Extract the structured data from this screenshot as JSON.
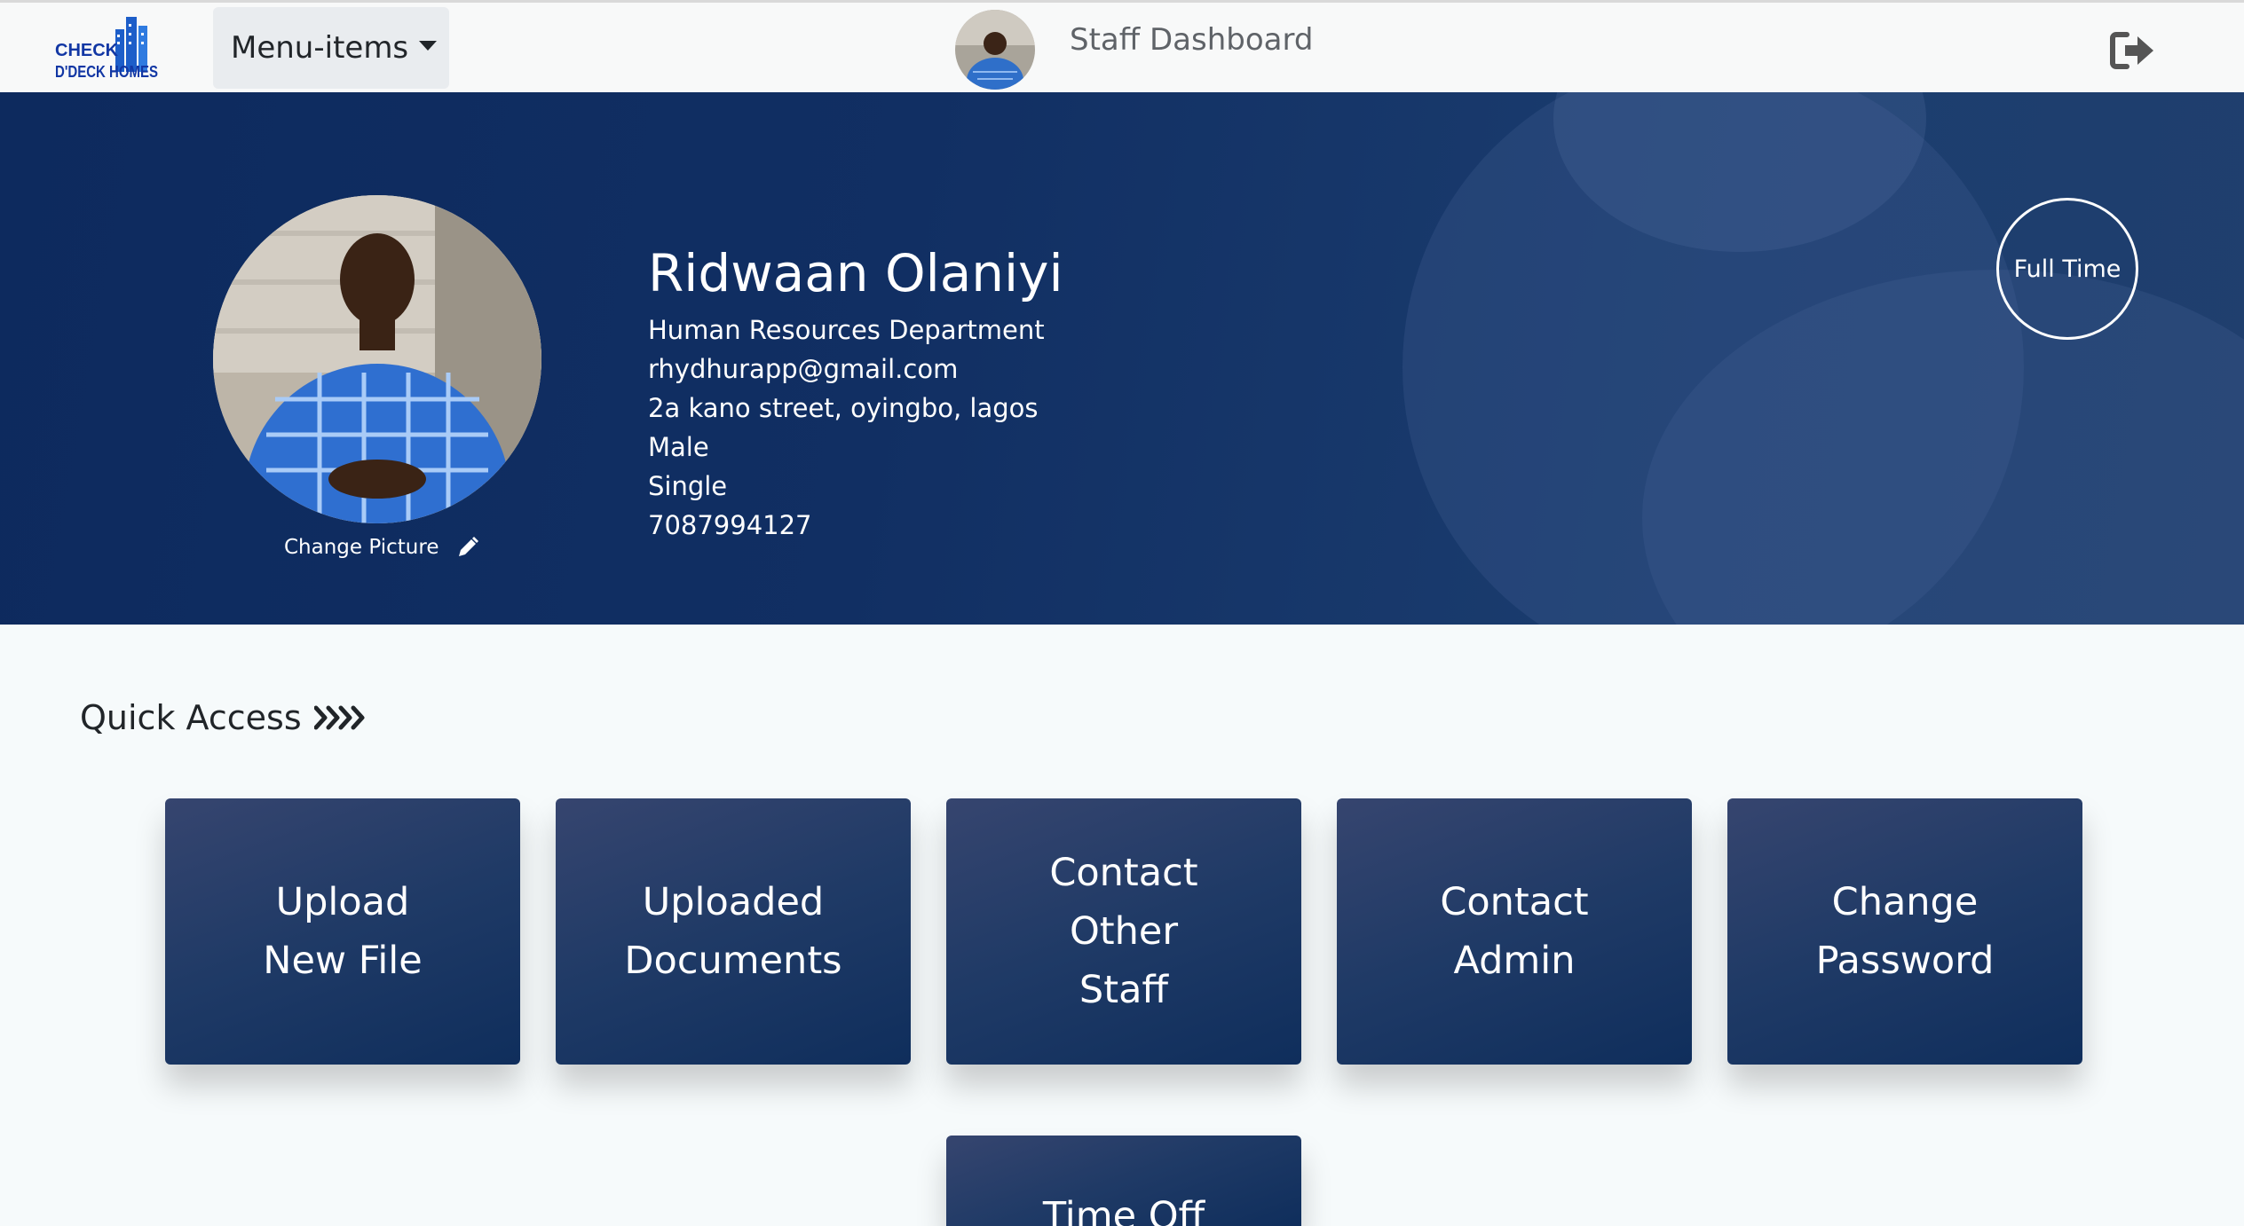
{
  "navbar": {
    "logo_text_line1": "CHECK",
    "logo_text_line2": "D'DECK HOMES",
    "menu_label": "Menu-items",
    "title": "Staff Dashboard",
    "logout_icon": "sign-out-icon"
  },
  "profile": {
    "name": "Ridwaan Olaniyi",
    "department": "Human Resources Department",
    "email": "rhydhurapp@gmail.com",
    "address": "2a kano street, oyingbo, lagos",
    "gender": "Male",
    "marital_status": "Single",
    "phone": "7087994127",
    "change_picture_label": "Change Picture",
    "employment_type": "Full Time"
  },
  "quick_access": {
    "title": "Quick Access",
    "cards": [
      {
        "line1": "Upload",
        "line2": "New File",
        "line3": ""
      },
      {
        "line1": "Uploaded",
        "line2": "Documents",
        "line3": ""
      },
      {
        "line1": "Contact",
        "line2": "Other",
        "line3": "Staff"
      },
      {
        "line1": "Contact",
        "line2": "Admin",
        "line3": ""
      },
      {
        "line1": "Change",
        "line2": "Password",
        "line3": ""
      },
      {
        "line1": "Time Off",
        "line2": "",
        "line3": ""
      }
    ]
  },
  "colors": {
    "hero_bg": "#112f63",
    "card_bg": "#1f3a66",
    "page_bg": "#f6fafb",
    "navbar_bg": "#f8f9f9"
  }
}
